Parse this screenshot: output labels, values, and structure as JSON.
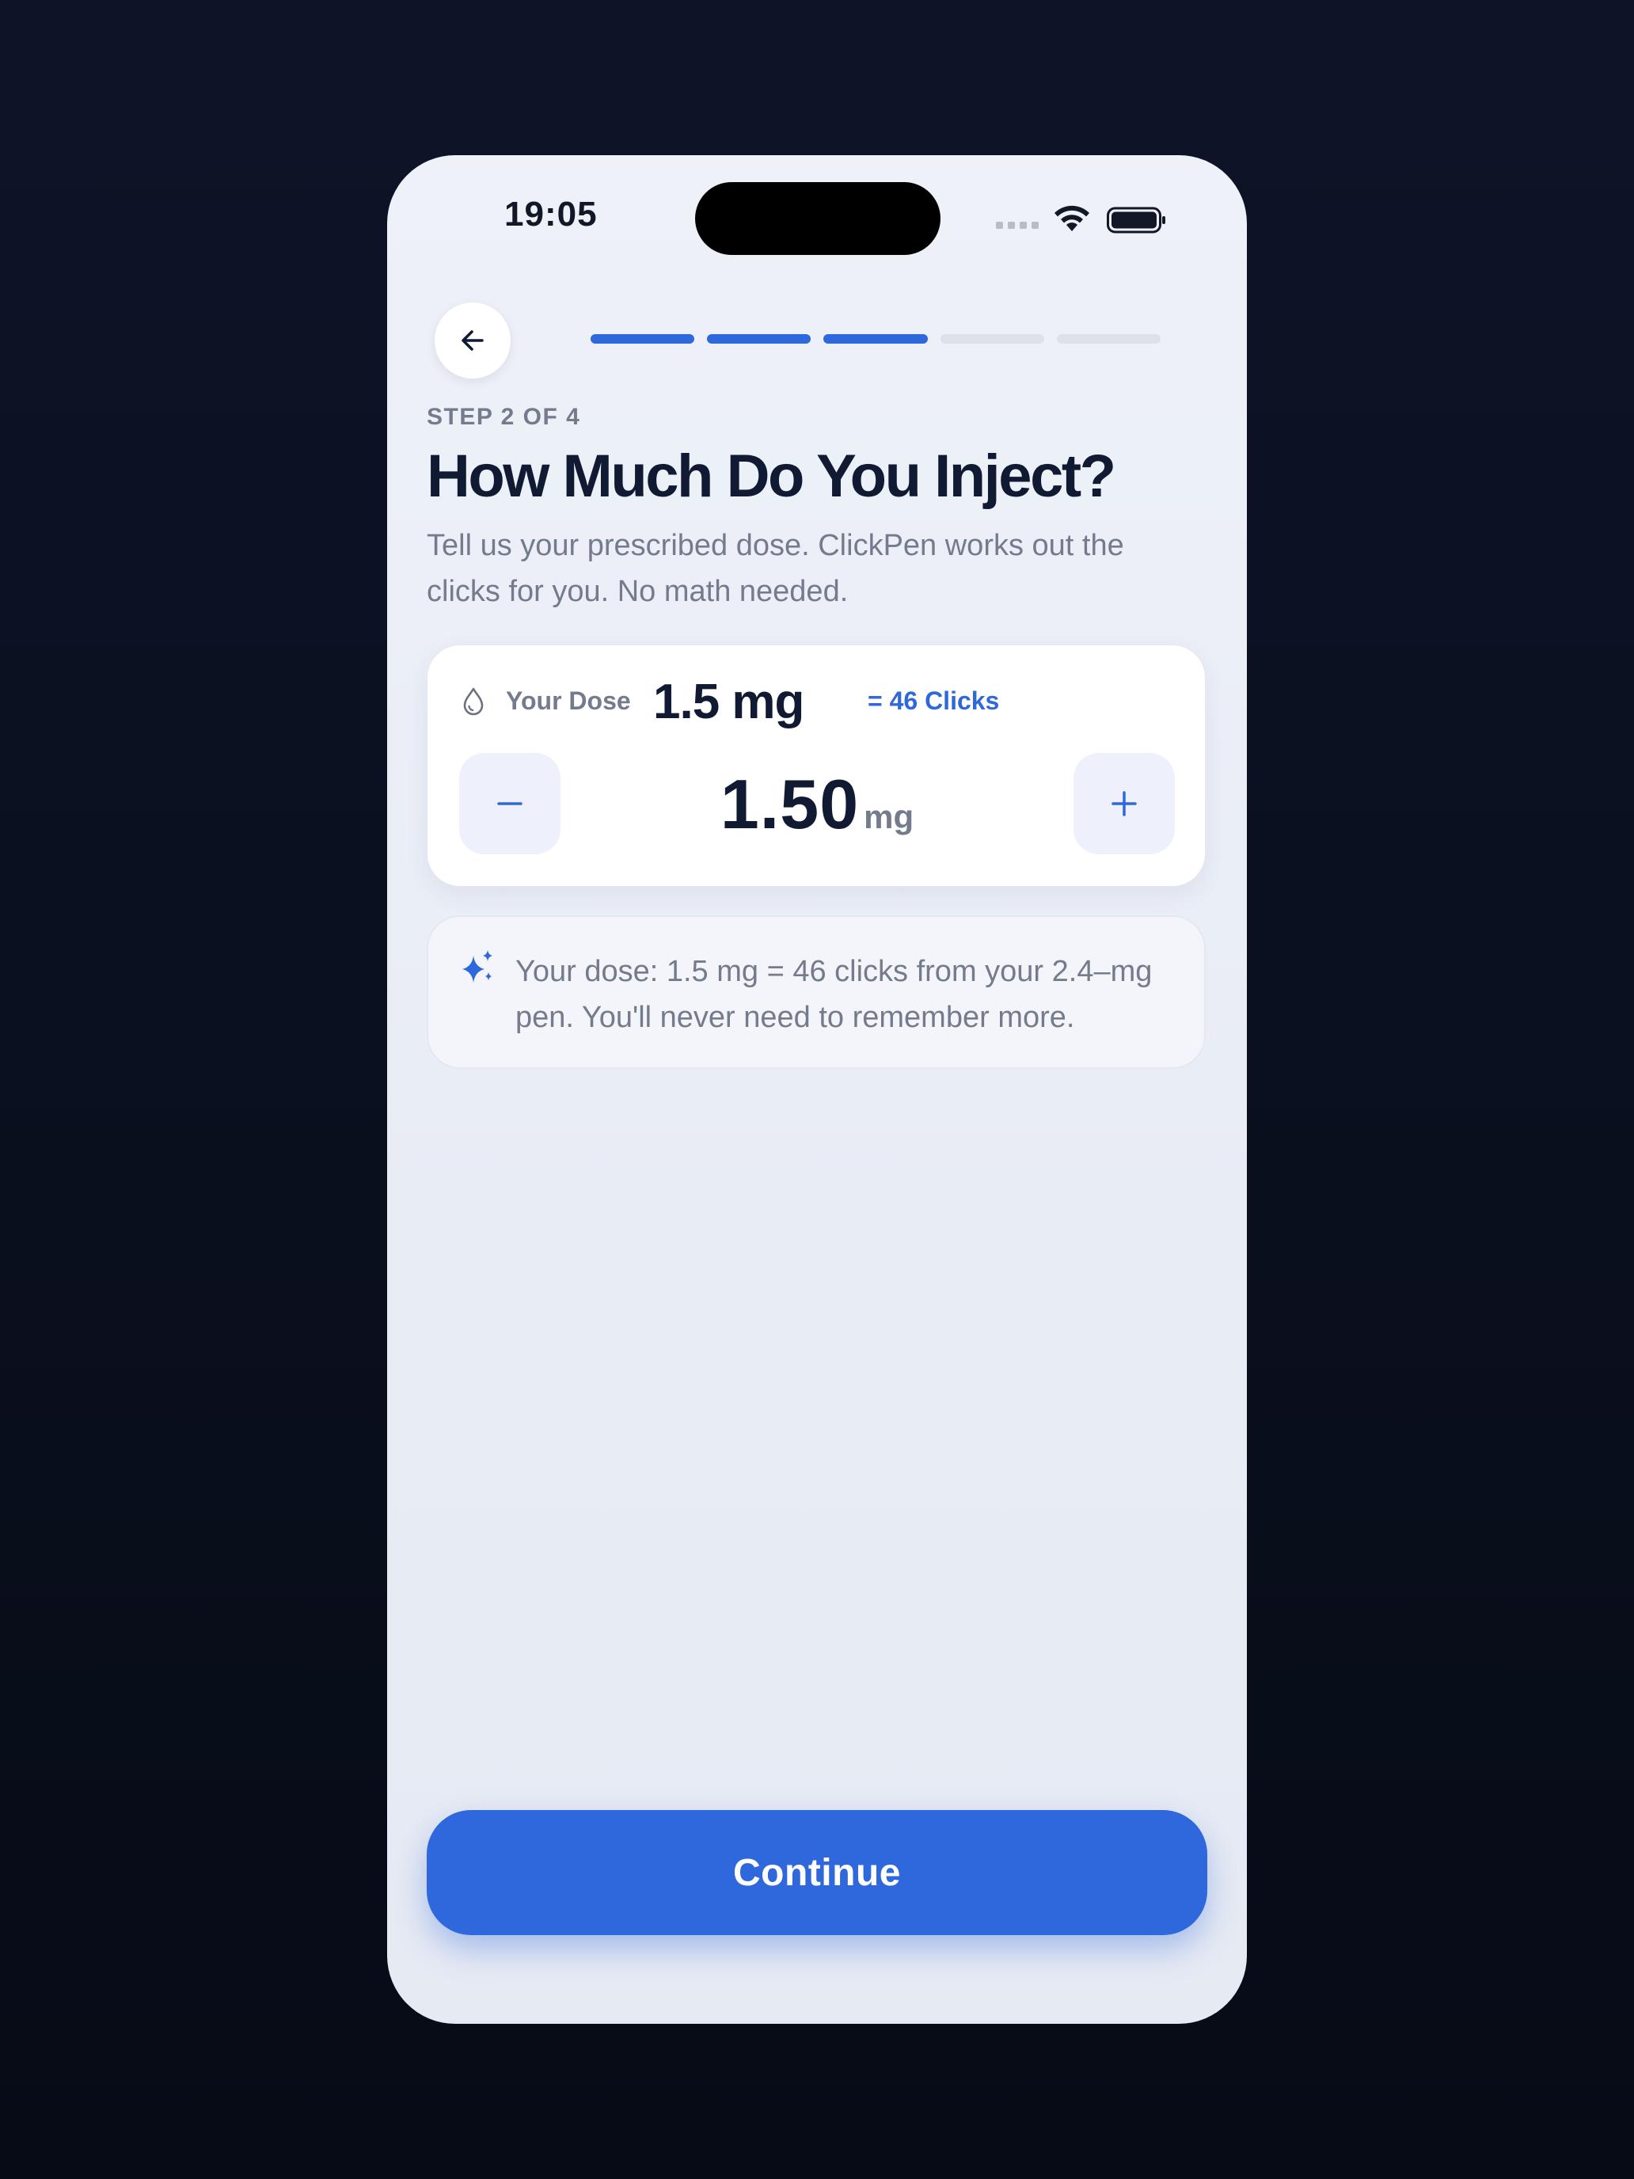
{
  "status_bar": {
    "time": "19:05"
  },
  "nav": {
    "back_icon": "arrow-left-icon",
    "progress": {
      "total_segments": 5,
      "completed_segments": 3
    }
  },
  "header": {
    "step_label": "STEP 2 OF 4",
    "title": "How Much Do You Inject?",
    "subtitle": "Tell us your prescribed dose. ClickPen works out the clicks for you. No math needed."
  },
  "dose_card": {
    "icon": "droplet-icon",
    "label": "Your Dose",
    "value": "1.5 mg",
    "clicks": "= 46 Clicks",
    "stepper": {
      "minus_symbol": "−",
      "plus_symbol": "+",
      "value": "1.50",
      "unit": "mg"
    }
  },
  "info_card": {
    "icon": "sparkle-icon",
    "text": "Your dose: 1.5 mg = 46 clicks from your 2.4–mg pen. You'll never need to remember more."
  },
  "footer": {
    "continue_label": "Continue"
  },
  "colors": {
    "accent": "#2f67dc",
    "heading": "#111a33",
    "muted": "#747b8c",
    "background": "#0a0f1e"
  }
}
